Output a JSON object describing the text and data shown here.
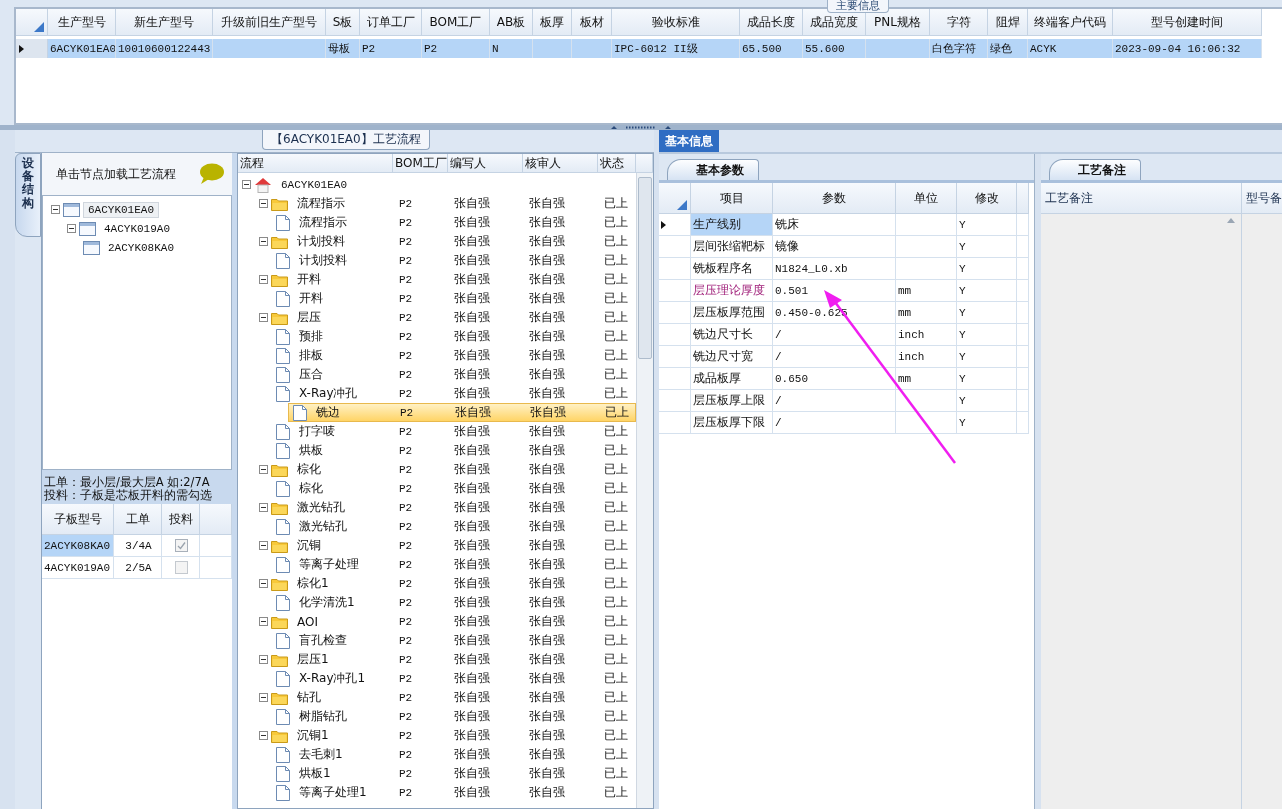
{
  "main_info": {
    "title": "主要信息",
    "columns": [
      "生产型号",
      "新生产型号",
      "升级前旧生产型号",
      "S板",
      "订单工厂",
      "BOM工厂",
      "AB板",
      "板厚",
      "板材",
      "验收标准",
      "成品长度",
      "成品宽度",
      "PNL规格",
      "字符",
      "阻焊",
      "终端客户代码",
      "型号创建时间"
    ],
    "rows": [
      {
        "selected": true,
        "cells": [
          "6ACYK01EA0",
          "10010600122443",
          null,
          "母板",
          "P2",
          "P2",
          "N",
          null,
          null,
          "IPC-6012 II级",
          "65.500",
          "55.600",
          null,
          "白色字符",
          "绿色",
          "ACYK",
          "2023-09-04 16:06:32"
        ]
      }
    ]
  },
  "flow_panel": {
    "title": "【6ACYK01EA0】工艺流程",
    "side_tab": "设备结构",
    "hint": "单击节点加载工艺流程",
    "structure_tree": [
      {
        "label": "6ACYK01EA0",
        "selected": true,
        "expanded": true,
        "children": [
          {
            "label": "4ACYK019A0",
            "selected": false,
            "expanded": true,
            "children": [
              {
                "label": "2ACYK08KA0",
                "selected": false
              }
            ]
          }
        ]
      }
    ],
    "notes": [
      "工单：最小层/最大层A 如:2/7A",
      "投料：子板是芯板开料的需勾选"
    ],
    "sub_boards": {
      "columns": [
        "子板型号",
        "工单",
        "投料"
      ],
      "rows": [
        {
          "model": "2ACYK08KA0",
          "order": "3/4A",
          "checked": true,
          "selected": true
        },
        {
          "model": "4ACYK019A0",
          "order": "2/5A",
          "checked": false,
          "selected": false
        }
      ]
    }
  },
  "process_tree": {
    "columns": [
      "流程",
      "BOM工厂",
      "编写人",
      "核审人",
      "状态"
    ],
    "nodes": [
      {
        "kind": "root",
        "label": "6ACYK01EA0",
        "expanded": true,
        "selected": false,
        "children": [
          {
            "kind": "folder",
            "label": "流程指示",
            "expanded": true,
            "selected": false,
            "bom": "P2",
            "writer": "张自强",
            "reviewer": "张自强",
            "status": "已上",
            "children": [
              {
                "kind": "step",
                "label": "流程指示",
                "selected": false,
                "bom": "P2",
                "writer": "张自强",
                "reviewer": "张自强",
                "status": "已上"
              }
            ]
          },
          {
            "kind": "folder",
            "label": "计划投料",
            "expanded": true,
            "selected": false,
            "bom": "P2",
            "writer": "张自强",
            "reviewer": "张自强",
            "status": "已上",
            "children": [
              {
                "kind": "step",
                "label": "计划投料",
                "selected": false,
                "bom": "P2",
                "writer": "张自强",
                "reviewer": "张自强",
                "status": "已上"
              }
            ]
          },
          {
            "kind": "folder",
            "label": "开料",
            "expanded": true,
            "selected": false,
            "bom": "P2",
            "writer": "张自强",
            "reviewer": "张自强",
            "status": "已上",
            "children": [
              {
                "kind": "step",
                "label": "开料",
                "selected": false,
                "bom": "P2",
                "writer": "张自强",
                "reviewer": "张自强",
                "status": "已上"
              }
            ]
          },
          {
            "kind": "folder",
            "label": "层压",
            "expanded": true,
            "selected": false,
            "bom": "P2",
            "writer": "张自强",
            "reviewer": "张自强",
            "status": "已上",
            "children": [
              {
                "kind": "step",
                "label": "预排",
                "selected": false,
                "bom": "P2",
                "writer": "张自强",
                "reviewer": "张自强",
                "status": "已上"
              },
              {
                "kind": "step",
                "label": "排板",
                "selected": false,
                "bom": "P2",
                "writer": "张自强",
                "reviewer": "张自强",
                "status": "已上"
              },
              {
                "kind": "step",
                "label": "压合",
                "selected": false,
                "bom": "P2",
                "writer": "张自强",
                "reviewer": "张自强",
                "status": "已上"
              },
              {
                "kind": "step",
                "label": "X-Ray冲孔",
                "selected": false,
                "bom": "P2",
                "writer": "张自强",
                "reviewer": "张自强",
                "status": "已上"
              },
              {
                "kind": "step",
                "label": "铣边",
                "selected": true,
                "bom": "P2",
                "writer": "张自强",
                "reviewer": "张自强",
                "status": "已上"
              },
              {
                "kind": "step",
                "label": "打字唛",
                "selected": false,
                "bom": "P2",
                "writer": "张自强",
                "reviewer": "张自强",
                "status": "已上"
              },
              {
                "kind": "step",
                "label": "烘板",
                "selected": false,
                "bom": "P2",
                "writer": "张自强",
                "reviewer": "张自强",
                "status": "已上"
              }
            ]
          },
          {
            "kind": "folder",
            "label": "棕化",
            "expanded": true,
            "selected": false,
            "bom": "P2",
            "writer": "张自强",
            "reviewer": "张自强",
            "status": "已上",
            "children": [
              {
                "kind": "step",
                "label": "棕化",
                "selected": false,
                "bom": "P2",
                "writer": "张自强",
                "reviewer": "张自强",
                "status": "已上"
              }
            ]
          },
          {
            "kind": "folder",
            "label": "激光钻孔",
            "expanded": true,
            "selected": false,
            "bom": "P2",
            "writer": "张自强",
            "reviewer": "张自强",
            "status": "已上",
            "children": [
              {
                "kind": "step",
                "label": "激光钻孔",
                "selected": false,
                "bom": "P2",
                "writer": "张自强",
                "reviewer": "张自强",
                "status": "已上"
              }
            ]
          },
          {
            "kind": "folder",
            "label": "沉铜",
            "expanded": true,
            "selected": false,
            "bom": "P2",
            "writer": "张自强",
            "reviewer": "张自强",
            "status": "已上",
            "children": [
              {
                "kind": "step",
                "label": "等离子处理",
                "selected": false,
                "bom": "P2",
                "writer": "张自强",
                "reviewer": "张自强",
                "status": "已上"
              }
            ]
          },
          {
            "kind": "folder",
            "label": "棕化1",
            "expanded": true,
            "selected": false,
            "bom": "P2",
            "writer": "张自强",
            "reviewer": "张自强",
            "status": "已上",
            "children": [
              {
                "kind": "step",
                "label": "化学清洗1",
                "selected": false,
                "bom": "P2",
                "writer": "张自强",
                "reviewer": "张自强",
                "status": "已上"
              }
            ]
          },
          {
            "kind": "folder",
            "label": "AOI",
            "expanded": true,
            "selected": false,
            "bom": "P2",
            "writer": "张自强",
            "reviewer": "张自强",
            "status": "已上",
            "children": [
              {
                "kind": "step",
                "label": "盲孔检查",
                "selected": false,
                "bom": "P2",
                "writer": "张自强",
                "reviewer": "张自强",
                "status": "已上"
              }
            ]
          },
          {
            "kind": "folder",
            "label": "层压1",
            "expanded": true,
            "selected": false,
            "bom": "P2",
            "writer": "张自强",
            "reviewer": "张自强",
            "status": "已上",
            "children": [
              {
                "kind": "step",
                "label": "X-Ray冲孔1",
                "selected": false,
                "bom": "P2",
                "writer": "张自强",
                "reviewer": "张自强",
                "status": "已上"
              }
            ]
          },
          {
            "kind": "folder",
            "label": "钻孔",
            "expanded": true,
            "selected": false,
            "bom": "P2",
            "writer": "张自强",
            "reviewer": "张自强",
            "status": "已上",
            "children": [
              {
                "kind": "step",
                "label": "树脂钻孔",
                "selected": false,
                "bom": "P2",
                "writer": "张自强",
                "reviewer": "张自强",
                "status": "已上"
              }
            ]
          },
          {
            "kind": "folder",
            "label": "沉铜1",
            "expanded": true,
            "selected": false,
            "bom": "P2",
            "writer": "张自强",
            "reviewer": "张自强",
            "status": "已上",
            "children": [
              {
                "kind": "step",
                "label": "去毛刺1",
                "selected": false,
                "bom": "P2",
                "writer": "张自强",
                "reviewer": "张自强",
                "status": "已上"
              },
              {
                "kind": "step",
                "label": "烘板1",
                "selected": false,
                "bom": "P2",
                "writer": "张自强",
                "reviewer": "张自强",
                "status": "已上"
              },
              {
                "kind": "step",
                "label": "等离子处理1",
                "selected": false,
                "bom": "P2",
                "writer": "张自强",
                "reviewer": "张自强",
                "status": "已上"
              }
            ]
          }
        ]
      }
    ]
  },
  "basic_info": {
    "tabs": [
      {
        "label": "基本信息",
        "selected": true
      }
    ],
    "params_tab": "基本参数",
    "columns": [
      "项目",
      "参数",
      "单位",
      "修改"
    ],
    "rows": [
      {
        "item": "生产线别",
        "value": "铣床",
        "modified": "Y",
        "selected": true,
        "highlighted": false
      },
      {
        "item": "层间张缩靶标",
        "value": "镜像",
        "modified": "Y",
        "selected": false,
        "highlighted": false
      },
      {
        "item": "铣板程序名",
        "value": "N1824_L0.xb",
        "modified": "Y",
        "selected": false,
        "highlighted": false
      },
      {
        "item": "层压理论厚度",
        "value": "0.501",
        "unit": "mm",
        "modified": "Y",
        "selected": false,
        "highlighted": true
      },
      {
        "item": "层压板厚范围",
        "value": "0.450-0.625",
        "unit": "mm",
        "modified": "Y",
        "selected": false,
        "highlighted": false
      },
      {
        "item": "铣边尺寸长",
        "value": "/",
        "unit": "inch",
        "modified": "Y",
        "selected": false,
        "highlighted": false
      },
      {
        "item": "铣边尺寸宽",
        "value": "/",
        "unit": "inch",
        "modified": "Y",
        "selected": false,
        "highlighted": false
      },
      {
        "item": "成品板厚",
        "value": "0.650",
        "unit": "mm",
        "modified": "Y",
        "selected": false,
        "highlighted": false
      },
      {
        "item": "层压板厚上限",
        "value": "/",
        "modified": "Y",
        "selected": false,
        "highlighted": false
      },
      {
        "item": "层压板厚下限",
        "value": "/",
        "modified": "Y",
        "selected": false,
        "highlighted": false
      }
    ],
    "notes_tab": "工艺备注",
    "notes_columns": [
      "工艺备注",
      "型号备"
    ]
  }
}
